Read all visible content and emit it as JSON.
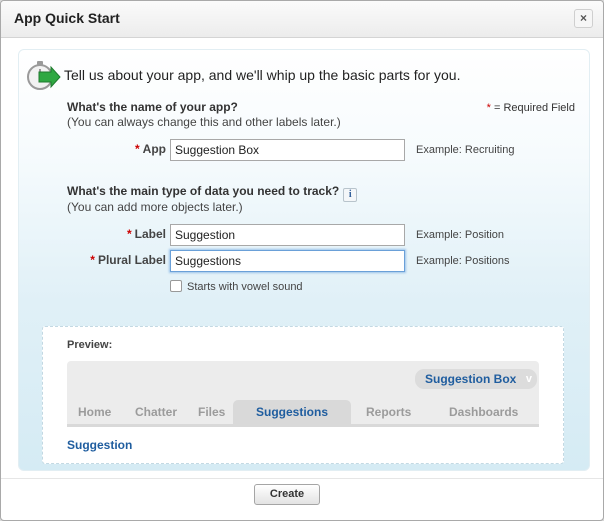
{
  "dialog": {
    "title": "App Quick Start",
    "close_symbol": "×",
    "intro": "Tell us about your app, and we'll whip up the basic parts for you.",
    "required_legend": "= Required Field"
  },
  "app_section": {
    "question": "What's the name of your app?",
    "hint": "(You can always change this and other labels later.)",
    "app_label": "App",
    "app_value": "Suggestion Box",
    "app_example": "Example: Recruiting"
  },
  "data_section": {
    "question": "What's the main type of data you need to track?",
    "info_symbol": "i",
    "hint": "(You can add more objects later.)",
    "label_label": "Label",
    "label_value": "Suggestion",
    "label_example": "Example: Position",
    "plural_label": "Plural Label",
    "plural_value": "Suggestions",
    "plural_example": "Example: Positions",
    "vowel_checkbox": "Starts with vowel sound",
    "vowel_checked": false
  },
  "preview": {
    "label": "Preview:",
    "app_picker": "Suggestion Box",
    "app_picker_chevron": "v",
    "tabs": [
      "Home",
      "Chatter",
      "Files",
      "Suggestions",
      "Reports",
      "Dashboards"
    ],
    "active_tab": "Suggestions",
    "link": "Suggestion"
  },
  "footer": {
    "create_label": "Create"
  },
  "colors": {
    "link_blue": "#1f5d9f",
    "required_red": "#cc0000",
    "panel_gradient_bottom": "#d5ebf4"
  }
}
